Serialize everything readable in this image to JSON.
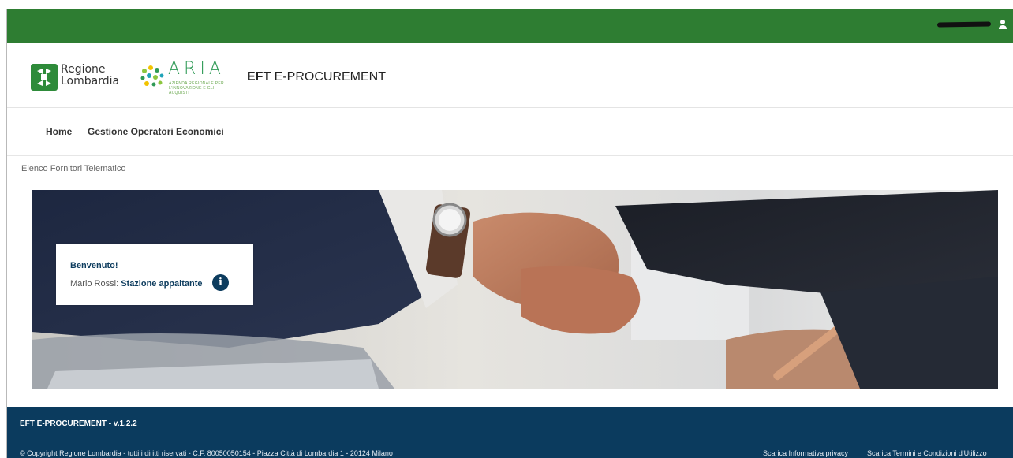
{
  "topbar": {
    "user_name": "",
    "user_icon": "user-icon"
  },
  "header": {
    "regione_line1": "Regione",
    "regione_line2": "Lombardia",
    "aria_name": "ARIA",
    "aria_subtitle": "AZIENDA REGIONALE PER L'INNOVAZIONE E GLI ACQUISTI",
    "app_title_bold": "EFT",
    "app_title_rest": " E-PROCUREMENT"
  },
  "nav": {
    "items": [
      {
        "label": "Home"
      },
      {
        "label": "Gestione Operatori Economici"
      }
    ]
  },
  "breadcrumb": "Elenco Fornitori Telematico",
  "welcome": {
    "title": "Benvenuto!",
    "user": "Mario Rossi:",
    "role": "Stazione appaltante",
    "info_icon": "info-icon"
  },
  "footer": {
    "version": "EFT E-PROCUREMENT - v.1.2.2",
    "copyright": "© Copyright Regione Lombardia - tutti i diritti riservati - C.F. 80050050154 - Piazza Città di Lombardia 1 - 20124 Milano",
    "privacy_link": "Scarica Informativa privacy",
    "terms_link": "Scarica Termini e Condizioni d'Utilizzo"
  },
  "colors": {
    "topbar": "#2e7d32",
    "footer": "#0b3b5e",
    "accent": "#0d3c5e"
  }
}
